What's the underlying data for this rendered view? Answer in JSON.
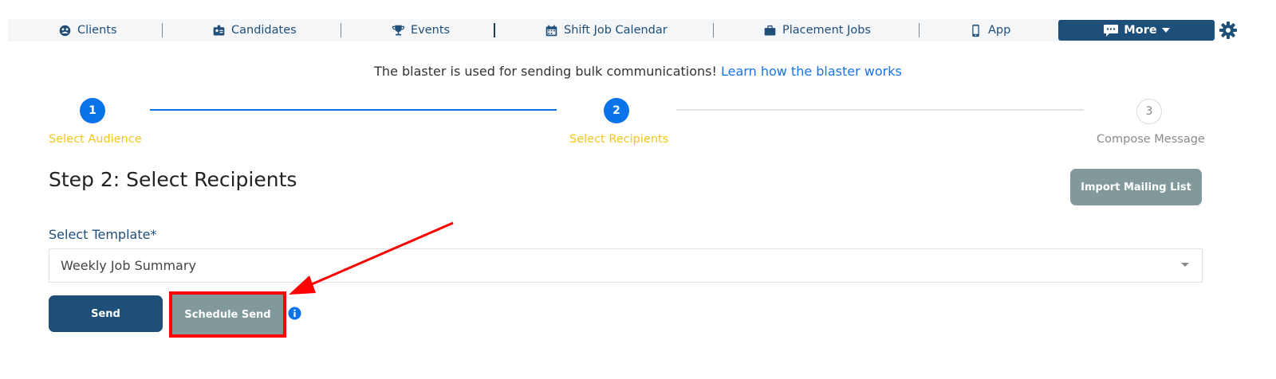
{
  "nav": {
    "items": [
      {
        "label": "Clients",
        "icon": "clients-icon"
      },
      {
        "label": "Candidates",
        "icon": "id-badge-icon"
      },
      {
        "label": "Events",
        "icon": "trophy-icon"
      },
      {
        "label": "Shift Job Calendar",
        "icon": "calendar-icon"
      },
      {
        "label": "Placement Jobs",
        "icon": "briefcase-icon"
      },
      {
        "label": "App",
        "icon": "phone-icon"
      }
    ],
    "more_label": "More",
    "more_icon": "chat-icon",
    "settings_icon": "gear-icon",
    "colors": {
      "text": "#1f4e79",
      "more_bg": "#1d4f79"
    }
  },
  "info": {
    "text": "The blaster is used for sending bulk communications!",
    "link": "Learn how the blaster works"
  },
  "stepper": {
    "steps": [
      {
        "number": "1",
        "label": "Select Audience",
        "state": "complete"
      },
      {
        "number": "2",
        "label": "Select Recipients",
        "state": "active"
      },
      {
        "number": "3",
        "label": "Compose Message",
        "state": "pending"
      }
    ],
    "colors": {
      "active": "#0a73e8",
      "label_active": "#f5c518",
      "label_pending": "#8a8a8a",
      "line_pending": "#e2e4e7"
    }
  },
  "main": {
    "title": "Step 2: Select Recipients",
    "import_button": "Import Mailing List",
    "template_label": "Select Template*",
    "template_value": "Weekly Job Summary",
    "send_button": "Send",
    "schedule_button": "Schedule Send",
    "info_icon": "info-icon"
  },
  "annotation": {
    "highlight_color": "#ff0000",
    "target": "Schedule Send"
  }
}
